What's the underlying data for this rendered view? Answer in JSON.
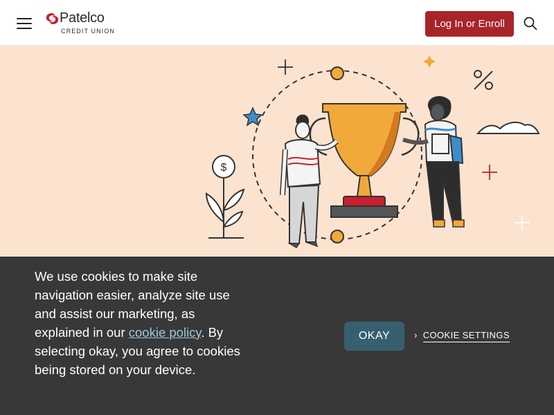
{
  "header": {
    "logo_name": "Patelco",
    "logo_sub": "CREDIT UNION",
    "login_label": "Log In or Enroll",
    "menu_icon": "hamburger-menu-icon",
    "search_icon": "search-icon"
  },
  "hero": {
    "illustration": "trophy-people-illustration",
    "coin_symbol": "$",
    "percent_symbol": "%"
  },
  "cookie": {
    "text_before": "We use cookies to make site navigation easier, analyze site use and assist our marketing, as explained in our ",
    "link_label": "cookie policy",
    "text_after": ". By selecting okay, you agree to cookies being stored on your device.",
    "okay_label": "OKAY",
    "settings_label": "COOKIE SETTINGS",
    "settings_chevron": "›"
  },
  "colors": {
    "brand_red": "#a82429",
    "hero_bg": "#fbe3cf",
    "banner_bg": "#383838",
    "okay_bg": "#36606f",
    "link": "#9ec7dd"
  }
}
